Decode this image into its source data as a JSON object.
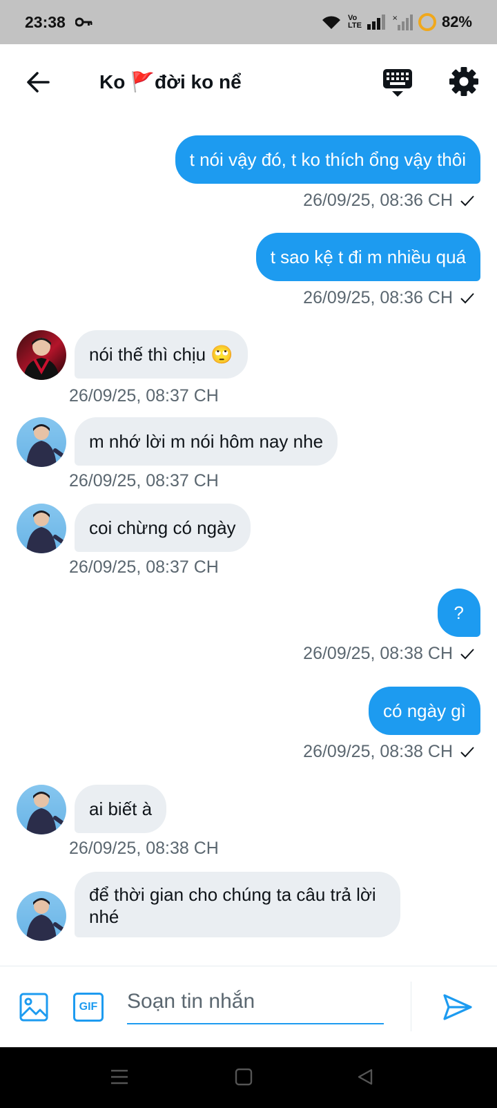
{
  "status": {
    "time": "23:38",
    "network": "Vo\nLTE",
    "battery": "82%"
  },
  "header": {
    "title": "Ko 🚩đời ko nể"
  },
  "messages": [
    {
      "dir": "out",
      "text": "t nói vậy đó, t ko thích ổng vậy thôi",
      "time": "26/09/25, 08:36 CH"
    },
    {
      "dir": "out",
      "text": "t sao kệ t đi m nhiều quá",
      "time": "26/09/25, 08:36 CH"
    },
    {
      "dir": "in",
      "text": "nói thế thì chịu 🙄",
      "time": "26/09/25, 08:37 CH",
      "avatar": "red"
    },
    {
      "dir": "in",
      "text": "m nhớ lời m nói hôm nay nhe",
      "time": "26/09/25, 08:37 CH",
      "avatar": "blue"
    },
    {
      "dir": "in",
      "text": "coi chừng có ngày",
      "time": "26/09/25, 08:37 CH",
      "avatar": "blue"
    },
    {
      "dir": "out",
      "text": "?",
      "time": "26/09/25, 08:38 CH"
    },
    {
      "dir": "out",
      "text": "có ngày gì",
      "time": "26/09/25, 08:38 CH"
    },
    {
      "dir": "in",
      "text": "ai biết à",
      "time": "26/09/25, 08:38 CH",
      "avatar": "blue"
    },
    {
      "dir": "in",
      "text": "để thời gian cho chúng ta câu trả lời nhé",
      "time": "",
      "avatar": "blue"
    }
  ],
  "composer": {
    "gif_label": "GIF",
    "placeholder": "Soạn tin nhắn"
  },
  "colors": {
    "accent": "#1d9bf0",
    "incoming_bubble": "#eaeef2",
    "meta_text": "#5b6770"
  },
  "icons": {
    "back": "back-arrow-icon",
    "keyboard": "keyboard-icon",
    "settings": "gear-icon",
    "image": "image-icon",
    "send": "send-icon"
  }
}
